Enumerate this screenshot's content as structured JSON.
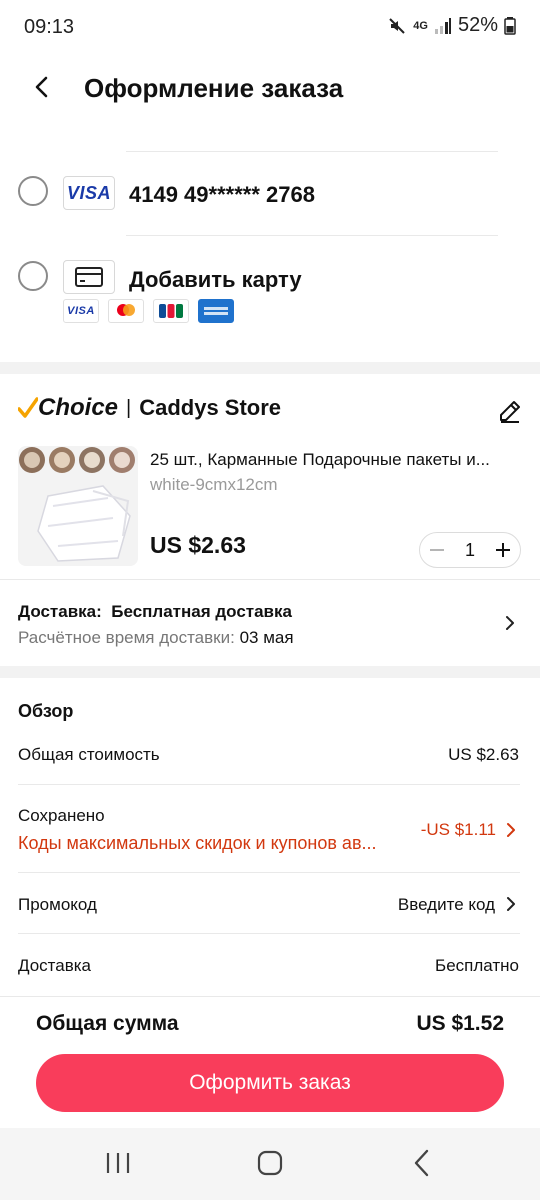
{
  "status_bar": {
    "time": "09:13",
    "network": "4G",
    "battery": "52%"
  },
  "header": {
    "title": "Оформление заказа"
  },
  "payment": {
    "saved_card": {
      "brand": "VISA",
      "number": "4149 49****** 2768"
    },
    "add_card": {
      "label": "Добавить карту",
      "logos": [
        "VISA",
        "mastercard",
        "JCB",
        "AMERICAN EXPRESS"
      ]
    }
  },
  "store": {
    "badge": "Choice",
    "name": "Caddys Store"
  },
  "product": {
    "title": "25 шт., Карманные Подарочные пакеты и...",
    "variant": "white-9cmx12cm",
    "price": "US $2.63",
    "quantity": "1"
  },
  "delivery": {
    "label": "Доставка:",
    "value": "Бесплатная доставка",
    "eta_label": "Расчётное время доставки:",
    "eta_value": "03 мая"
  },
  "summary": {
    "heading": "Обзор",
    "rows": [
      {
        "label": "Общая стоимость",
        "value": "US $2.63"
      },
      {
        "label": "Сохранено",
        "sublabel": "Коды максимальных скидок и купонов ав...",
        "value": "-US $1.11"
      },
      {
        "label": "Промокод",
        "value": "Введите код"
      },
      {
        "label": "Доставка",
        "value": "Бесплатно"
      }
    ]
  },
  "total": {
    "label": "Общая сумма",
    "value": "US $1.52"
  },
  "cta": {
    "label": "Оформить заказ"
  },
  "colors": {
    "accent": "#f93d5b",
    "discount": "#d2380f",
    "choice_check": "#f5a300"
  },
  "icons": [
    "mute-icon",
    "signal-icon",
    "battery-icon",
    "back-arrow-icon",
    "card-icon",
    "edit-icon",
    "chevron-right-icon",
    "minus-icon",
    "plus-icon",
    "recent-apps-icon",
    "home-icon",
    "back-nav-icon"
  ]
}
